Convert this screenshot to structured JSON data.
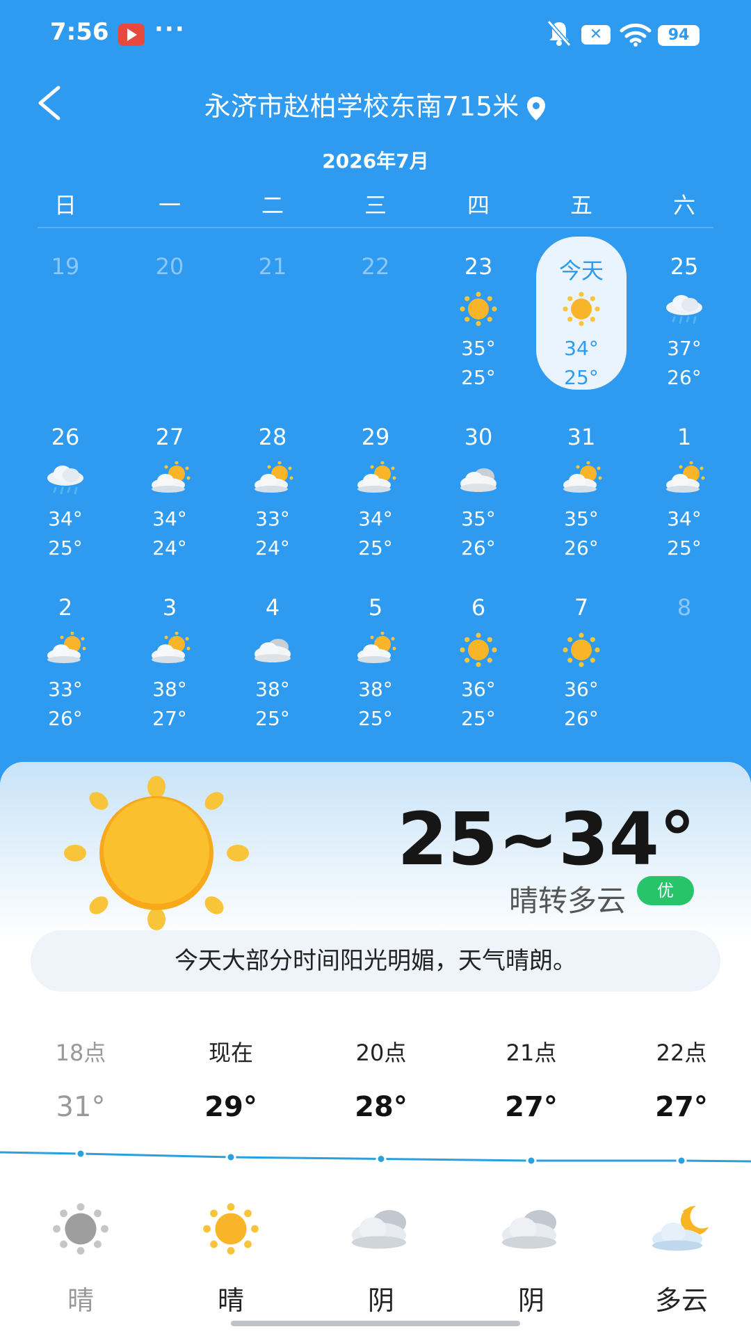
{
  "status_bar": {
    "time": "7:56",
    "more": "···",
    "battery": "94",
    "x_badge": "✕"
  },
  "header": {
    "title": "永济市赵柏学校东南715米",
    "month": "2026年7月"
  },
  "weekdays": [
    "日",
    "一",
    "二",
    "三",
    "四",
    "五",
    "六"
  ],
  "calendar": [
    {
      "date": "19",
      "faded": true
    },
    {
      "date": "20",
      "faded": true
    },
    {
      "date": "21",
      "faded": true
    },
    {
      "date": "22",
      "faded": true
    },
    {
      "date": "23",
      "icon": "sun-icon",
      "high": "35°",
      "low": "25°"
    },
    {
      "date": "今天",
      "icon": "sun-icon",
      "high": "34°",
      "low": "25°",
      "today": true
    },
    {
      "date": "25",
      "icon": "rain-cloud-icon",
      "high": "37°",
      "low": "26°"
    },
    {
      "date": "26",
      "icon": "rain-cloud-icon",
      "high": "34°",
      "low": "25°"
    },
    {
      "date": "27",
      "icon": "partly-cloudy-icon",
      "high": "34°",
      "low": "24°"
    },
    {
      "date": "28",
      "icon": "partly-cloudy-icon",
      "high": "33°",
      "low": "24°"
    },
    {
      "date": "29",
      "icon": "partly-cloudy-icon",
      "high": "34°",
      "low": "25°"
    },
    {
      "date": "30",
      "icon": "cloud-icon",
      "high": "35°",
      "low": "26°"
    },
    {
      "date": "31",
      "icon": "partly-cloudy-icon",
      "high": "35°",
      "low": "26°"
    },
    {
      "date": "1",
      "icon": "partly-cloudy-icon",
      "high": "34°",
      "low": "25°"
    },
    {
      "date": "2",
      "icon": "partly-cloudy-icon",
      "high": "33°",
      "low": "26°"
    },
    {
      "date": "3",
      "icon": "partly-cloudy-icon",
      "high": "38°",
      "low": "27°"
    },
    {
      "date": "4",
      "icon": "cloud-icon",
      "high": "38°",
      "low": "25°"
    },
    {
      "date": "5",
      "icon": "partly-cloudy-icon",
      "high": "38°",
      "low": "25°"
    },
    {
      "date": "6",
      "icon": "sun-icon",
      "high": "36°",
      "low": "25°"
    },
    {
      "date": "7",
      "icon": "sun-icon",
      "high": "36°",
      "low": "26°"
    },
    {
      "date": "8",
      "faded": true
    }
  ],
  "today": {
    "range": "25~34°",
    "condition": "晴转多云",
    "aqi": "优",
    "summary": "今天大部分时间阳光明媚，天气晴朗。"
  },
  "hourly": [
    {
      "label": "18点",
      "temp": "31°",
      "cond": "晴",
      "icon": "sun-grey-icon",
      "past": true
    },
    {
      "label": "现在",
      "temp": "29°",
      "cond": "晴",
      "icon": "sun-icon"
    },
    {
      "label": "20点",
      "temp": "28°",
      "cond": "阴",
      "icon": "overcast-icon"
    },
    {
      "label": "21点",
      "temp": "27°",
      "cond": "阴",
      "icon": "overcast-icon"
    },
    {
      "label": "22点",
      "temp": "27°",
      "cond": "多云",
      "icon": "night-partly-cloudy-icon"
    }
  ],
  "hourly_temps": [
    31,
    29,
    28,
    27,
    27
  ],
  "colors": {
    "background": "#2E9AF0",
    "today_highlight": "#EAF4FE",
    "aqi_good": "#27C46A",
    "line": "#2AA0DE"
  }
}
